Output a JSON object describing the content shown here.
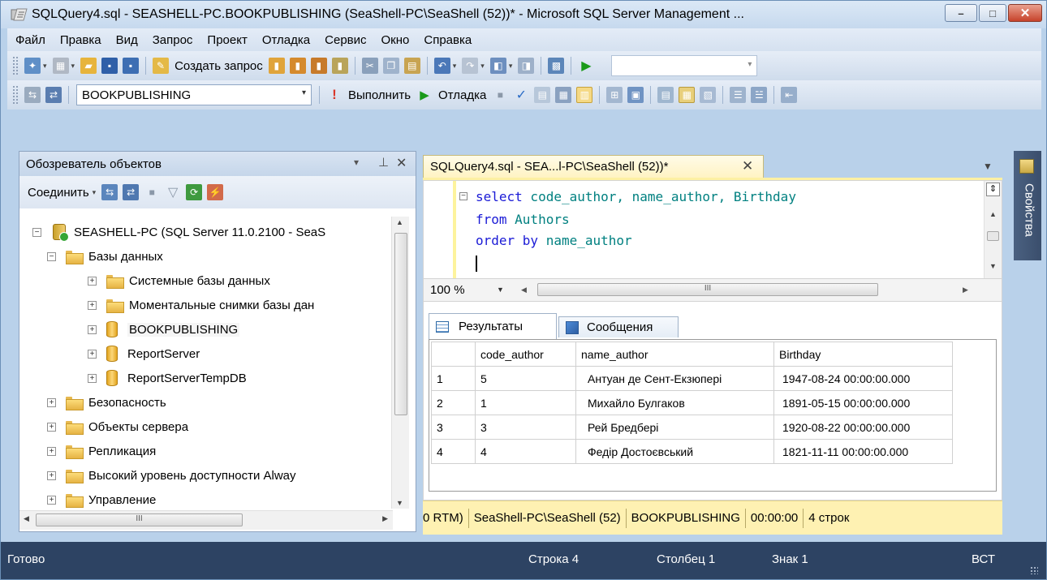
{
  "window": {
    "title": "SQLQuery4.sql - SEASHELL-PC.BOOKPUBLISHING (SeaShell-PC\\SeaShell (52))* - Microsoft SQL Server Management ...",
    "minimize_label": "–",
    "maximize_label": "□",
    "close_label": "✕"
  },
  "menu": [
    "Файл",
    "Правка",
    "Вид",
    "Запрос",
    "Проект",
    "Отладка",
    "Сервис",
    "Окно",
    "Справка"
  ],
  "toolbar1": {
    "new_query_label": "Создать запрос"
  },
  "toolbar2": {
    "database_selected": "BOOKPUBLISHING",
    "execute_label": "Выполнить",
    "debug_label": "Отладка"
  },
  "object_explorer": {
    "title": "Обозреватель объектов",
    "connect_label": "Соединить",
    "pin_label": "▾ ⊥",
    "close_label": "✕",
    "server": "SEASHELL-PC (SQL Server 11.0.2100 - SeaS",
    "databases_folder": "Базы данных",
    "system_databases": "Системные базы данных",
    "snapshots": "Моментальные снимки базы дан",
    "db_bookpublishing": "BOOKPUBLISHING",
    "db_reportserver": "ReportServer",
    "db_reportservertemp": "ReportServerTempDB",
    "security": "Безопасность",
    "server_objects": "Объекты сервера",
    "replication": "Репликация",
    "alwayson": "Высокий уровень доступности Alway",
    "management": "Управление",
    "hscroll_mark": "III"
  },
  "document": {
    "tab_label": "SQLQuery4.sql - SEA...l-PC\\SeaShell (52))*",
    "tab_close": "✕",
    "code": {
      "line1_kw": "select",
      "line1_rest": " code_author, name_author, Birthday",
      "line2_kw": "from",
      "line2_rest": " Authors",
      "line3_kw": "order by",
      "line3_rest": " name_author"
    },
    "zoom": "100 %",
    "hscroll_mark": "III"
  },
  "results": {
    "tab_results": "Результаты",
    "tab_messages": "Сообщения",
    "columns": [
      "code_author",
      "name_author",
      "Birthday"
    ],
    "rows": [
      {
        "n": "1",
        "code_author": "5",
        "name_author": "Антуан де Сент-Екзюпері",
        "birthday": "1947-08-24 00:00:00.000"
      },
      {
        "n": "2",
        "code_author": "1",
        "name_author": "Михайло Булгаков",
        "birthday": "1891-05-15 00:00:00.000"
      },
      {
        "n": "3",
        "code_author": "3",
        "name_author": "Рей Бредбері",
        "birthday": "1920-08-22 00:00:00.000"
      },
      {
        "n": "4",
        "code_author": "4",
        "name_author": "Федір Достоєвський",
        "birthday": "1821-11-11 00:00:00.000"
      }
    ]
  },
  "query_status": {
    "version": "0 RTM)",
    "user": "SeaShell-PC\\SeaShell (52)",
    "database": "BOOKPUBLISHING",
    "time": "00:00:00",
    "rows": "4 строк"
  },
  "properties_strip": {
    "label": "Свойства"
  },
  "statusbar": {
    "ready": "Готово",
    "line": "Строка 4",
    "column": "Столбец 1",
    "char": "Знак 1",
    "mode": "ВСТ"
  }
}
